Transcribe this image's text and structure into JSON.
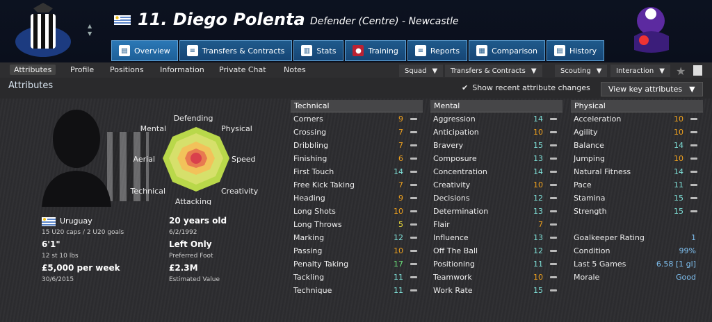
{
  "header": {
    "player_title": "11. Diego Polenta",
    "player_role": "Defender (Centre) - Newcastle"
  },
  "tabs": [
    {
      "label": "Overview",
      "icon": "overview-icon"
    },
    {
      "label": "Transfers & Contracts",
      "icon": "contract-icon"
    },
    {
      "label": "Stats",
      "icon": "stats-icon"
    },
    {
      "label": "Training",
      "icon": "training-icon"
    },
    {
      "label": "Reports",
      "icon": "report-icon"
    },
    {
      "label": "Comparison",
      "icon": "comparison-icon"
    },
    {
      "label": "History",
      "icon": "history-icon"
    }
  ],
  "subnav": {
    "items": [
      "Attributes",
      "Profile",
      "Positions",
      "Information",
      "Private Chat",
      "Notes"
    ],
    "dropdowns": [
      "Squad",
      "Transfers & Contracts",
      "Scouting",
      "Interaction"
    ]
  },
  "section": {
    "title": "Attributes",
    "show_changes": "Show recent attribute changes",
    "key_button": "View key attributes"
  },
  "radar": {
    "labels": [
      "Defending",
      "Physical",
      "Speed",
      "Creativity",
      "Attacking",
      "Technical",
      "Aerial",
      "Mental"
    ]
  },
  "bio": {
    "nation": "Uruguay",
    "caps": "15 U20 caps / 2 U20 goals",
    "height": "6'1\"",
    "weight": "12 st 10 lbs",
    "wage": "£5,000 per week",
    "contract": "30/6/2015",
    "age": "20 years old",
    "dob": "6/2/1992",
    "foot": "Left Only",
    "foot_label": "Preferred Foot",
    "value": "£2.3M",
    "value_label": "Estimated Value"
  },
  "technical": {
    "title": "Technical",
    "rows": [
      {
        "name": "Corners",
        "value": "9"
      },
      {
        "name": "Crossing",
        "value": "7"
      },
      {
        "name": "Dribbling",
        "value": "7"
      },
      {
        "name": "Finishing",
        "value": "6"
      },
      {
        "name": "First Touch",
        "value": "14"
      },
      {
        "name": "Free Kick Taking",
        "value": "7"
      },
      {
        "name": "Heading",
        "value": "9"
      },
      {
        "name": "Long Shots",
        "value": "10"
      },
      {
        "name": "Long Throws",
        "value": "5"
      },
      {
        "name": "Marking",
        "value": "12"
      },
      {
        "name": "Passing",
        "value": "10"
      },
      {
        "name": "Penalty Taking",
        "value": "17"
      },
      {
        "name": "Tackling",
        "value": "11"
      },
      {
        "name": "Technique",
        "value": "11"
      }
    ]
  },
  "mental": {
    "title": "Mental",
    "rows": [
      {
        "name": "Aggression",
        "value": "14"
      },
      {
        "name": "Anticipation",
        "value": "10"
      },
      {
        "name": "Bravery",
        "value": "15"
      },
      {
        "name": "Composure",
        "value": "13"
      },
      {
        "name": "Concentration",
        "value": "14"
      },
      {
        "name": "Creativity",
        "value": "10"
      },
      {
        "name": "Decisions",
        "value": "12"
      },
      {
        "name": "Determination",
        "value": "13"
      },
      {
        "name": "Flair",
        "value": "7"
      },
      {
        "name": "Influence",
        "value": "13"
      },
      {
        "name": "Off The Ball",
        "value": "12"
      },
      {
        "name": "Positioning",
        "value": "11"
      },
      {
        "name": "Teamwork",
        "value": "10"
      },
      {
        "name": "Work Rate",
        "value": "15"
      }
    ]
  },
  "physical": {
    "title": "Physical",
    "rows": [
      {
        "name": "Acceleration",
        "value": "10"
      },
      {
        "name": "Agility",
        "value": "10"
      },
      {
        "name": "Balance",
        "value": "14"
      },
      {
        "name": "Jumping",
        "value": "10"
      },
      {
        "name": "Natural Fitness",
        "value": "14"
      },
      {
        "name": "Pace",
        "value": "11"
      },
      {
        "name": "Stamina",
        "value": "15"
      },
      {
        "name": "Strength",
        "value": "15"
      }
    ]
  },
  "status": [
    {
      "name": "Goalkeeper Rating",
      "value": "1"
    },
    {
      "name": "Condition",
      "value": "99%"
    },
    {
      "name": "Last 5 Games",
      "value": "6.58 [1 gl]"
    },
    {
      "name": "Morale",
      "value": "Good"
    }
  ]
}
